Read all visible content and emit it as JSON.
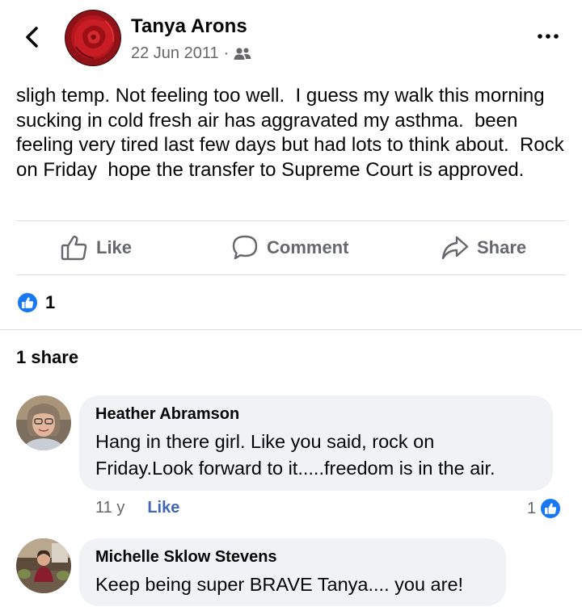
{
  "post": {
    "author": "Tanya Arons",
    "date": "22 Jun 2011",
    "privacy_icon": "friends-icon",
    "text": "sligh temp. Not feeling too well.  I guess my walk this morning sucking in cold fresh air has aggravated my asthma.  been feeling very tired last few days but had lots to think about.  Rock on Friday  hope the transfer to Supreme Court is approved."
  },
  "actions": {
    "like_label": "Like",
    "comment_label": "Comment",
    "share_label": "Share"
  },
  "reactions": {
    "count": "1",
    "icon": "thumbs-up-icon"
  },
  "shares": {
    "label": "1 share"
  },
  "comments": [
    {
      "name": "Heather Abramson",
      "text": "Hang in there girl. Like you said, rock on Friday.Look forward to it.....freedom is in the air.",
      "time": "11 y",
      "like_label": "Like",
      "reaction_count": "1"
    },
    {
      "name": "Michelle Sklow Stevens",
      "text": "Keep being super BRAVE Tanya.... you are!"
    }
  ],
  "colors": {
    "accent": "#1877f2",
    "secondary_text": "#65676b",
    "bubble": "#f0f2f5",
    "divider": "#dadde1"
  }
}
